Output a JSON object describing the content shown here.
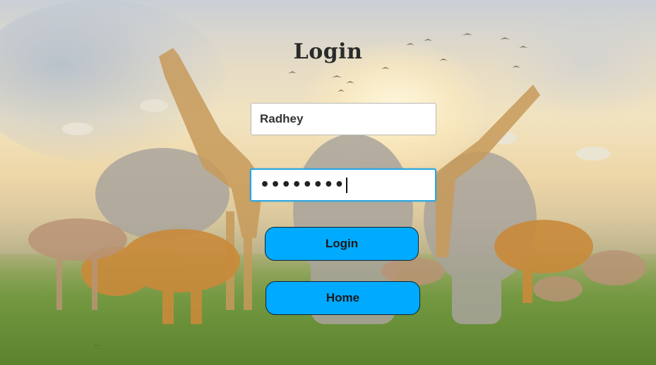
{
  "page": {
    "title": "Login"
  },
  "form": {
    "username_value": "Radhey",
    "password_masked": "••••••••",
    "login_label": "Login",
    "home_label": "Home"
  },
  "colors": {
    "button_bg": "#00aaff",
    "focus_border": "#2aa6df",
    "title_color": "#2a2a2a"
  },
  "background": {
    "icon": "wildlife-scene-image"
  }
}
